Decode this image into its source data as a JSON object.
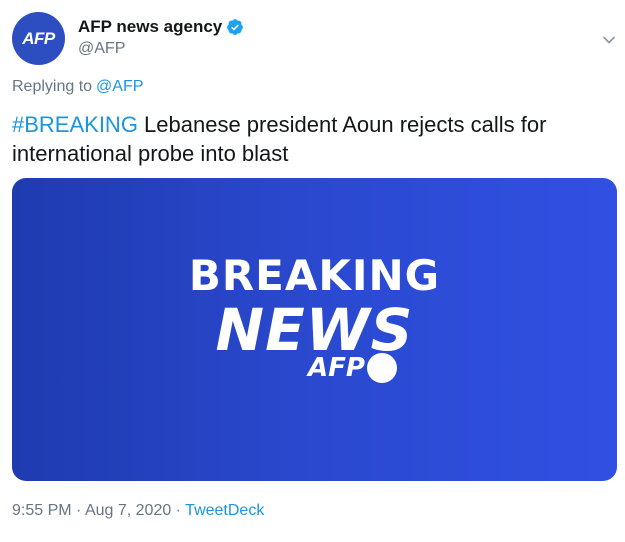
{
  "author": {
    "avatar_text": "AFP",
    "name": "AFP news agency",
    "handle": "@AFP",
    "verified": true
  },
  "reply": {
    "prefix": "Replying to",
    "target": "@AFP"
  },
  "tweet": {
    "hashtag": "#BREAKING",
    "text": " Lebanese president Aoun rejects calls for international probe into blast"
  },
  "media": {
    "line1": "BREAKING",
    "line2": "NEWS",
    "logo": "AFP"
  },
  "meta": {
    "time": "9:55 PM",
    "date": "Aug 7, 2020",
    "separator": " · ",
    "source": "TweetDeck"
  },
  "colors": {
    "link": "#1b95e0",
    "muted": "#657786",
    "brand": "#2d4ec0"
  }
}
